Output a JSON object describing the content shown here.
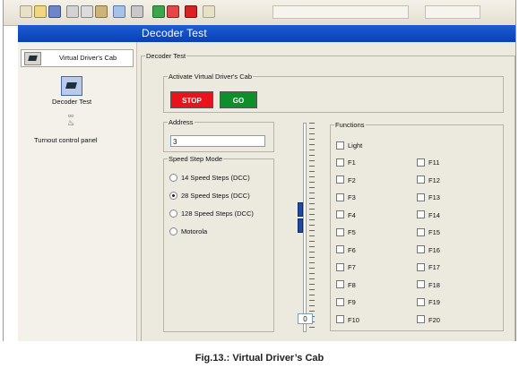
{
  "window": {
    "title": "Decoder Test"
  },
  "sidebar": {
    "cab_button_label": "Virtual Driver's Cab",
    "items": [
      {
        "label": "Decoder Test",
        "icon": "locomotive-icon"
      },
      {
        "label": "Turnout control panel",
        "icon": "turnout-icon"
      }
    ]
  },
  "main": {
    "group_title": "Decoder Test",
    "activate": {
      "title": "Activate Virtual Driver's Cab",
      "stop_label": "STOP",
      "go_label": "GO",
      "stop_color": "#e8131b",
      "go_color": "#0f8f2a"
    },
    "address": {
      "title": "Address",
      "value": "3"
    },
    "speed_step": {
      "title": "Speed Step Mode",
      "options": [
        {
          "label": "14 Speed Steps (DCC)",
          "checked": false
        },
        {
          "label": "28 Speed Steps (DCC)",
          "checked": true
        },
        {
          "label": "128 Speed Steps (DCC)",
          "checked": false
        },
        {
          "label": "Motorola",
          "checked": false
        }
      ]
    },
    "speed_slider": {
      "value": "0"
    },
    "functions": {
      "title": "Functions",
      "light": "Light",
      "left": [
        "F1",
        "F2",
        "F3",
        "F4",
        "F5",
        "F6",
        "F7",
        "F8",
        "F9",
        "F10"
      ],
      "right": [
        "F11",
        "F12",
        "F13",
        "F14",
        "F15",
        "F16",
        "F17",
        "F18",
        "F19",
        "F20"
      ]
    }
  },
  "caption": "Fig.13.: Virtual Driver’s Cab"
}
